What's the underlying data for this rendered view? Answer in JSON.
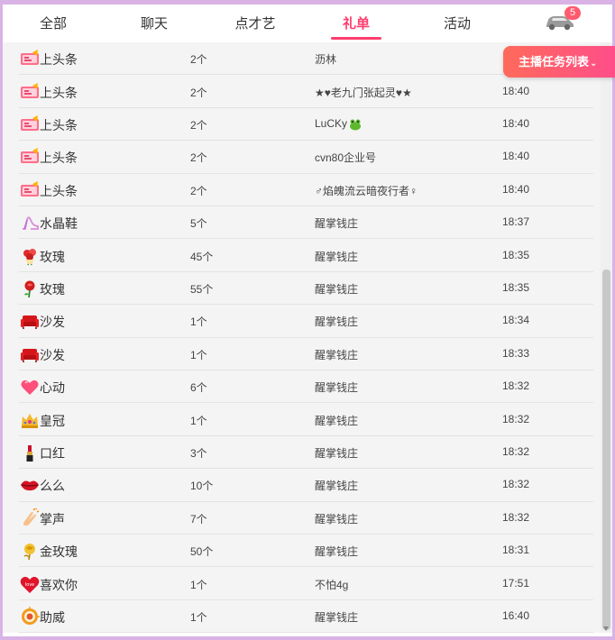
{
  "tabs": [
    {
      "label": "全部"
    },
    {
      "label": "聊天"
    },
    {
      "label": "点才艺"
    },
    {
      "label": "礼单"
    },
    {
      "label": "活动"
    }
  ],
  "active_tab": "礼单",
  "vehicle_badge": "5",
  "task_button": {
    "label": "主播任务列表",
    "chevron": "⌄"
  },
  "gifts": [
    {
      "name": "上头条",
      "count": "2个",
      "sender": "沥林",
      "time": "",
      "icon": "headline-gift-icon"
    },
    {
      "name": "上头条",
      "count": "2个",
      "sender": "★♥老九门张起灵♥★",
      "time": "18:40",
      "icon": "headline-gift-icon"
    },
    {
      "name": "上头条",
      "count": "2个",
      "sender": "LuCKy",
      "time": "18:40",
      "icon": "headline-gift-icon"
    },
    {
      "name": "上头条",
      "count": "2个",
      "sender": "cvn80企业号",
      "time": "18:40",
      "icon": "headline-gift-icon"
    },
    {
      "name": "上头条",
      "count": "2个",
      "sender": "♂焰魄流云暗夜行者♀",
      "time": "18:40",
      "icon": "headline-gift-icon"
    },
    {
      "name": "水晶鞋",
      "count": "5个",
      "sender": "醒掌钱庄",
      "time": "18:37",
      "icon": "crystal-shoe-icon"
    },
    {
      "name": "玫瑰",
      "count": "45个",
      "sender": "醒掌钱庄",
      "time": "18:35",
      "icon": "rose-bouquet-icon"
    },
    {
      "name": "玫瑰",
      "count": "55个",
      "sender": "醒掌钱庄",
      "time": "18:35",
      "icon": "rose-icon"
    },
    {
      "name": "沙发",
      "count": "1个",
      "sender": "醒掌钱庄",
      "time": "18:34",
      "icon": "sofa-icon"
    },
    {
      "name": "沙发",
      "count": "1个",
      "sender": "醒掌钱庄",
      "time": "18:33",
      "icon": "sofa-icon"
    },
    {
      "name": "心动",
      "count": "6个",
      "sender": "醒掌钱庄",
      "time": "18:32",
      "icon": "heart-icon"
    },
    {
      "name": "皇冠",
      "count": "1个",
      "sender": "醒掌钱庄",
      "time": "18:32",
      "icon": "crown-icon"
    },
    {
      "name": "口红",
      "count": "3个",
      "sender": "醒掌钱庄",
      "time": "18:32",
      "icon": "lipstick-icon"
    },
    {
      "name": "么么",
      "count": "10个",
      "sender": "醒掌钱庄",
      "time": "18:32",
      "icon": "kiss-lips-icon"
    },
    {
      "name": "掌声",
      "count": "7个",
      "sender": "醒掌钱庄",
      "time": "18:32",
      "icon": "clap-icon"
    },
    {
      "name": "金玫瑰",
      "count": "50个",
      "sender": "醒掌钱庄",
      "time": "18:31",
      "icon": "gold-rose-icon"
    },
    {
      "name": "喜欢你",
      "count": "1个",
      "sender": "不怕4g",
      "time": "17:51",
      "icon": "love-heart-icon"
    },
    {
      "name": "助威",
      "count": "1个",
      "sender": "醒掌钱庄",
      "time": "16:40",
      "icon": "cheer-icon"
    }
  ],
  "colors": {
    "accent": "#ff3d6e",
    "frame": "#d9b3e6",
    "button_start": "#ff6a5b",
    "button_end": "#ff4e8a",
    "list_bg": "#f4f4f4"
  }
}
